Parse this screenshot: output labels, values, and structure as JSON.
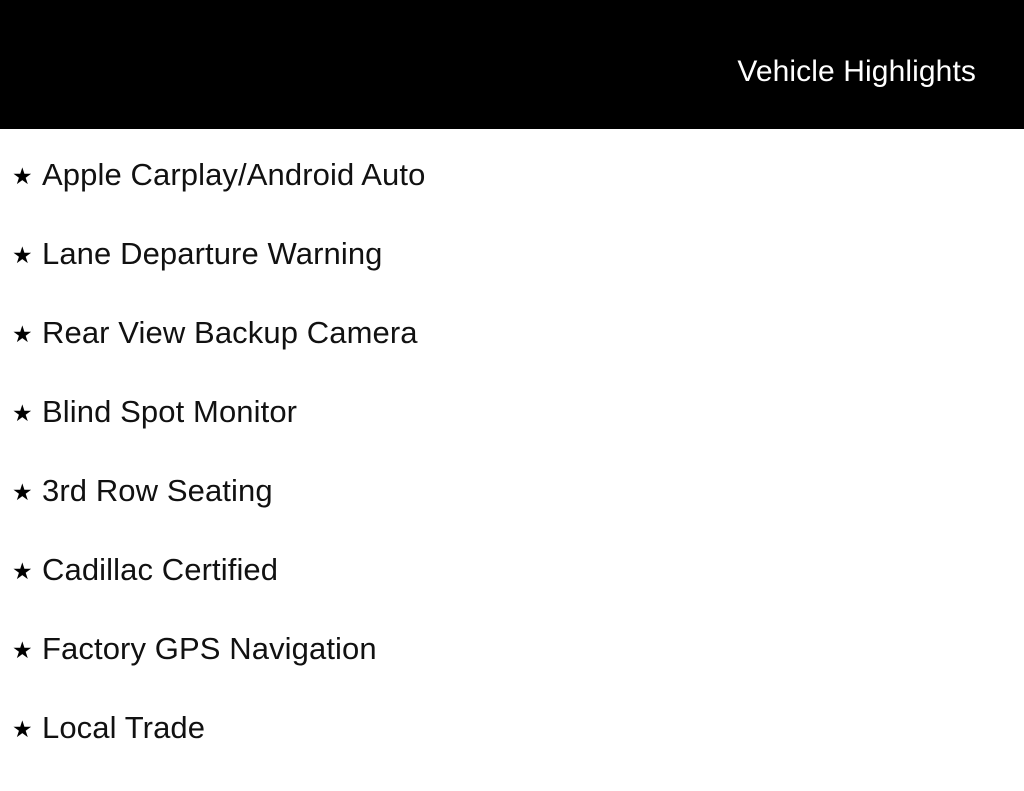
{
  "header": {
    "title": "Vehicle Highlights",
    "background_color": "#000000",
    "text_color": "#ffffff"
  },
  "page": {
    "background_color": "#ffffff",
    "text_color": "#111111"
  },
  "highlights": {
    "bullet_icon": "star-icon",
    "bullet_glyph": "★",
    "items": [
      {
        "label": "Apple Carplay/Android Auto"
      },
      {
        "label": "Lane Departure Warning"
      },
      {
        "label": "Rear View Backup Camera"
      },
      {
        "label": "Blind Spot Monitor"
      },
      {
        "label": "3rd Row Seating"
      },
      {
        "label": "Cadillac Certified"
      },
      {
        "label": "Factory GPS Navigation"
      },
      {
        "label": "Local Trade"
      }
    ]
  }
}
